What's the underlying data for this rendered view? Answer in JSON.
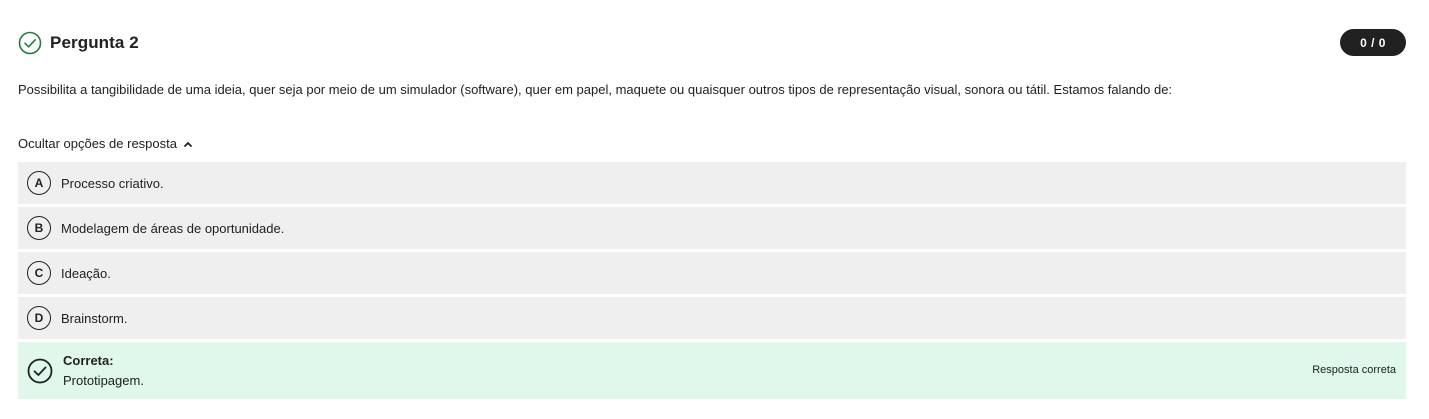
{
  "question": {
    "title": "Pergunta 2",
    "score": "0 / 0",
    "text": "Possibilita a tangibilidade de uma ideia, quer seja por meio de um simulador (software), quer em papel, maquete ou quaisquer outros tipos de representação visual, sonora ou tátil. Estamos falando de:",
    "toggle_label": "Ocultar opções de resposta",
    "status_icon": "check-circle-icon",
    "status_color": "#1e7d3e"
  },
  "options": [
    {
      "letter": "A",
      "text": "Processo criativo."
    },
    {
      "letter": "B",
      "text": "Modelagem de áreas de oportunidade."
    },
    {
      "letter": "C",
      "text": "Ideação."
    },
    {
      "letter": "D",
      "text": "Brainstorm."
    }
  ],
  "correct": {
    "label": "Correta:",
    "text": "Prototipagem.",
    "tag": "Resposta correta",
    "background": "#dff8e9"
  }
}
